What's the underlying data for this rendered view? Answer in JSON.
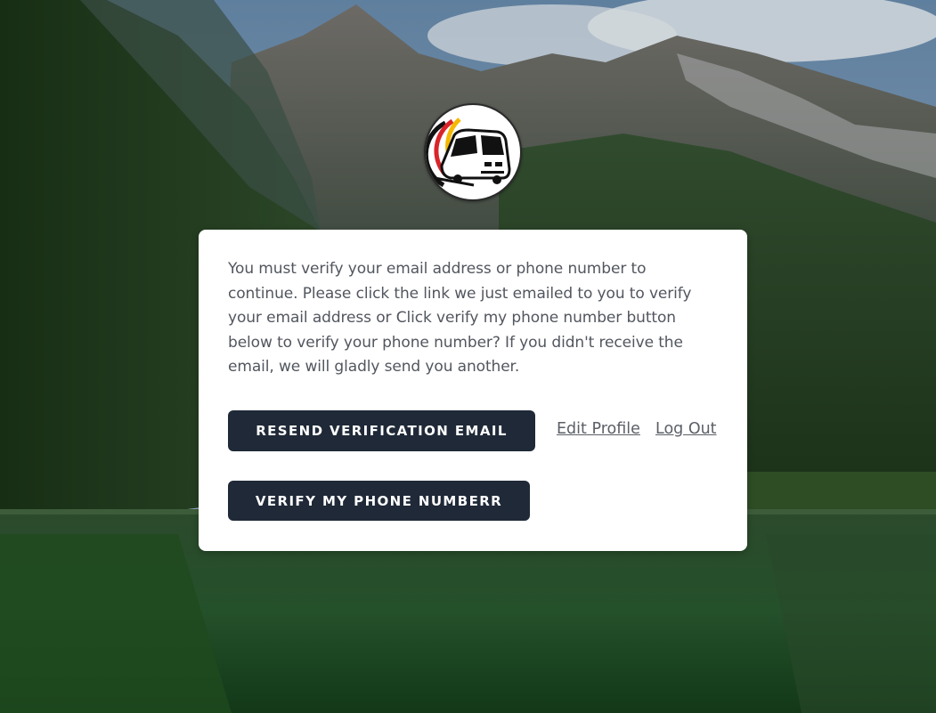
{
  "logo": {
    "icon": "bus-logo-icon",
    "colors": [
      "#111111",
      "#d9252a",
      "#f5b800"
    ]
  },
  "verification": {
    "message": "You must verify your email address or phone number to continue. Please click the link we just emailed to you to verify your email address or Click verify my phone number button below to verify your phone number? If you didn't receive the email, we will gladly send you another.",
    "resend_label": "Resend Verification Email",
    "verify_phone_label": "Verify My Phone Numberr",
    "edit_profile_label": "Edit Profile",
    "logout_label": "Log Out"
  },
  "theme": {
    "button_bg": "#1f2937",
    "card_bg": "#ffffff",
    "text": "#52565e"
  }
}
